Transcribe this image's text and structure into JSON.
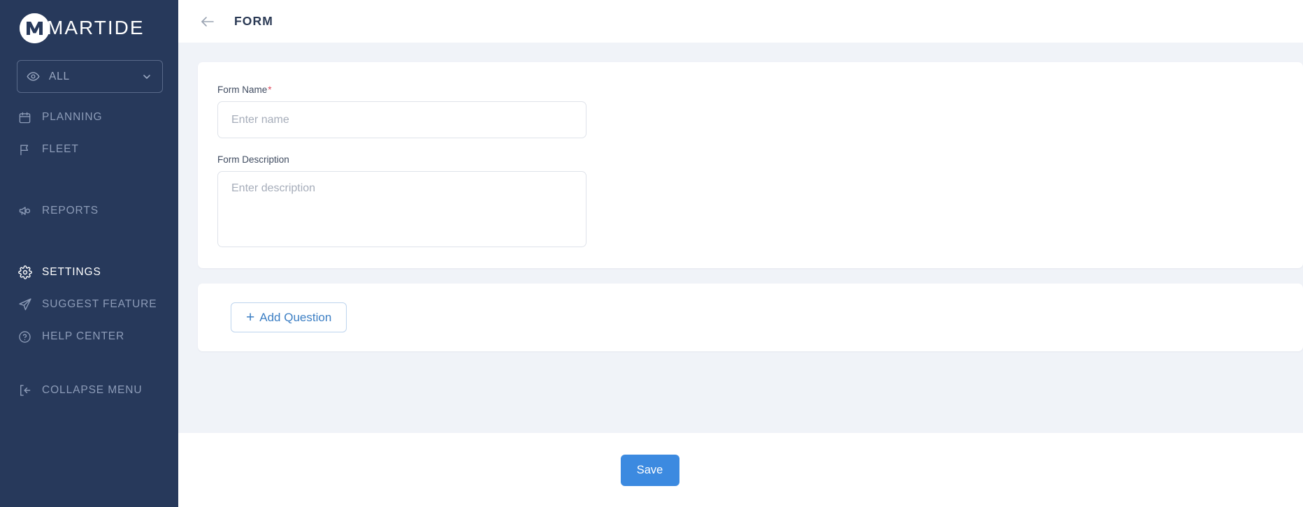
{
  "sidebar": {
    "brand": {
      "name": "MARTIDE",
      "mark_letter": "M"
    },
    "scope_selector": {
      "label": "ALL",
      "icon": "eye-icon",
      "chevron": "chevron-down-icon"
    },
    "items": [
      {
        "label": "PLANNING",
        "icon": "calendar-icon",
        "active": false
      },
      {
        "label": "FLEET",
        "icon": "flag-icon",
        "active": false
      },
      {
        "label": "REPORTS",
        "icon": "megaphone-icon",
        "active": false
      },
      {
        "label": "SETTINGS",
        "icon": "gear-icon",
        "active": true
      },
      {
        "label": "SUGGEST FEATURE",
        "icon": "send-icon",
        "active": false
      },
      {
        "label": "HELP CENTER",
        "icon": "question-circle-icon",
        "active": false
      }
    ],
    "collapse": {
      "label": "COLLAPSE MENU",
      "icon": "collapse-left-icon"
    }
  },
  "header": {
    "back_icon": "arrow-left-icon",
    "title": "FORM"
  },
  "form": {
    "name_field": {
      "label": "Form Name",
      "required_mark": "*",
      "placeholder": "Enter name",
      "value": ""
    },
    "description_field": {
      "label": "Form Description",
      "placeholder": "Enter description",
      "value": ""
    },
    "add_question_button": {
      "plus": "+",
      "label": "Add Question"
    }
  },
  "footer": {
    "save_label": "Save"
  },
  "colors": {
    "sidebar_bg": "#27395b",
    "content_bg": "#f0f3f8",
    "accent_blue": "#3c8ae0",
    "link_blue": "#3d7fc4",
    "required_red": "#e0485c",
    "title_navy": "#2b3a55"
  }
}
